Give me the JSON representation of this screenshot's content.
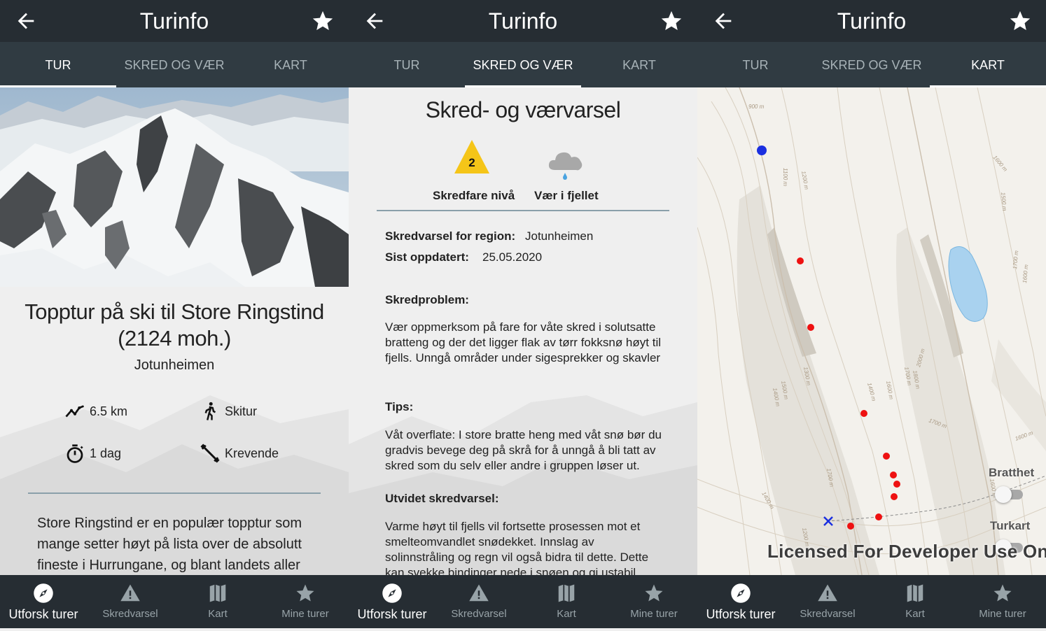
{
  "common": {
    "app_title": "Turinfo",
    "tabs": [
      "TUR",
      "SKRED OG VÆR",
      "KART"
    ],
    "nav": [
      {
        "label": "Utforsk turer",
        "icon": "compass-icon"
      },
      {
        "label": "Skredvarsel",
        "icon": "warning-triangle-icon"
      },
      {
        "label": "Kart",
        "icon": "map-icon"
      },
      {
        "label": "Mine turer",
        "icon": "star-icon"
      }
    ]
  },
  "screen1": {
    "active_tab": 0,
    "title": "Topptur på ski til Store Ringstind (2124 moh.)",
    "region": "Jotunheimen",
    "stats": {
      "distance": "6.5 km",
      "type": "Skitur",
      "duration": "1 dag",
      "difficulty": "Krevende"
    },
    "description": "Store Ringstind er en populær topptur som mange setter høyt på lista over de absolutt fineste i Hurrungane, og blant landets aller"
  },
  "screen2": {
    "active_tab": 1,
    "heading": "Skred- og værvarsel",
    "danger_level": "2",
    "danger_label": "Skredfare nivå",
    "weather_label": "Vær i fjellet",
    "region_label": "Skredvarsel for region:",
    "region_value": "Jotunheimen",
    "updated_label": "Sist oppdatert:",
    "updated_value": "25.05.2020",
    "problem_heading": "Skredproblem:",
    "problem_text": "Vær oppmerksom på fare for våte skred i solutsatte bratteng og der det ligger flak av tørr fokksnø høyt til fjells. Unngå områder under sigesprekker og skavler",
    "tips_heading": "Tips:",
    "tips_text": "Våt overflate: I store bratte heng med våt snø bør du gradvis bevege deg på skrå for å unngå å bli tatt av skred som du selv eller andre i gruppen løser ut.",
    "extended_heading": "Utvidet skredvarsel:",
    "extended_text": "Varme høyt til fjells vil fortsette prosessen mot et smelteomvandlet snødekket. Innslag av solinnstråling og regn vil også bidra til dette. Dette kan svekke bindinger nede i snøen og gi ustabil"
  },
  "screen3": {
    "active_tab": 2,
    "layers": [
      "Bratthet",
      "Turkart"
    ],
    "watermark": "Licensed For Developer Use Only",
    "contour_labels": [
      "900 m",
      "1100 m",
      "1200 m",
      "1600 m",
      "1500 m",
      "1700 m",
      "1600 m",
      "1400 m",
      "1300 m",
      "1500 m",
      "1400 m",
      "1600 m",
      "1700 m",
      "1800 m",
      "2000 m",
      "1700 m",
      "1600 m",
      "1700 m",
      "1400 m",
      "1200 m",
      "1600 m"
    ],
    "colors": {
      "route_point": "#ee1111",
      "start_point": "#1a2fe0",
      "marker": "#1a2fe0"
    }
  }
}
